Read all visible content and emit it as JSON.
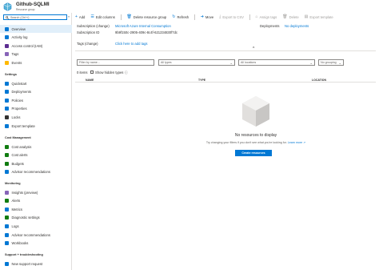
{
  "header": {
    "title": "Github-SQLMI",
    "subtitle": "Resource group"
  },
  "sidebar": {
    "search_placeholder": "Search (Ctrl+/)",
    "collapse_glyph": "«",
    "items_top": [
      {
        "label": "Overview",
        "color": "#0078d4"
      },
      {
        "label": "Activity log",
        "color": "#0078d4"
      },
      {
        "label": "Access control (IAM)",
        "color": "#5c2d91"
      },
      {
        "label": "Tags",
        "color": "#8764b8"
      },
      {
        "label": "Events",
        "color": "#ffb900"
      }
    ],
    "settings_header": "Settings",
    "items_settings": [
      {
        "label": "Quickstart",
        "color": "#0078d4"
      },
      {
        "label": "Deployments",
        "color": "#0078d4"
      },
      {
        "label": "Policies",
        "color": "#0078d4"
      },
      {
        "label": "Properties",
        "color": "#0078d4"
      },
      {
        "label": "Locks",
        "color": "#323130"
      },
      {
        "label": "Export template",
        "color": "#0078d4"
      }
    ],
    "cost_header": "Cost Management",
    "items_cost": [
      {
        "label": "Cost analysis",
        "color": "#107c10"
      },
      {
        "label": "Cost alerts",
        "color": "#107c10"
      },
      {
        "label": "Budgets",
        "color": "#107c10"
      },
      {
        "label": "Advisor recommendations",
        "color": "#0078d4"
      }
    ],
    "monitoring_header": "Monitoring",
    "items_monitoring": [
      {
        "label": "Insights (preview)",
        "color": "#8764b8"
      },
      {
        "label": "Alerts",
        "color": "#107c10"
      },
      {
        "label": "Metrics",
        "color": "#0078d4"
      },
      {
        "label": "Diagnostic settings",
        "color": "#107c10"
      },
      {
        "label": "Logs",
        "color": "#0078d4"
      },
      {
        "label": "Advisor recommendations",
        "color": "#0078d4"
      },
      {
        "label": "Workbooks",
        "color": "#0078d4"
      }
    ],
    "support_header": "Support + troubleshooting",
    "items_support": [
      {
        "label": "New support request",
        "color": "#0078d4"
      }
    ]
  },
  "toolbar": {
    "add": "Add",
    "edit_columns": "Edit columns",
    "delete_group": "Delete resource group",
    "refresh": "Refresh",
    "move": "Move",
    "export_csv": "Export to CSV",
    "assign_tags": "Assign tags",
    "delete": "Delete",
    "export_template": "Export template"
  },
  "essentials": {
    "subscription_label": "Subscription (change)",
    "subscription_value": "Microsoft Azure Internal Consumption",
    "subscription_id_label": "Subscription ID",
    "subscription_id_value": "9b9f150c-2905-409c-8c4f-621234830f7dc",
    "tags_label": "Tags (change)",
    "tags_value": "Click here to add tags",
    "deployments_label": "Deployments",
    "deployments_value": "No deployments",
    "collapse_glyph": "^"
  },
  "filters": {
    "name_placeholder": "Filter by name...",
    "type_value": "All types",
    "location_value": "All locations",
    "grouping_value": "No grouping"
  },
  "list": {
    "count": "0 items",
    "show_hidden": "Show hidden types",
    "info_glyph": "ⓘ",
    "columns": {
      "name": "NAME",
      "type": "TYPE",
      "location": "LOCATION"
    }
  },
  "empty_state": {
    "title": "No resources to display",
    "description": "Try changing your filters if you don't see what you're looking for.",
    "learn_more": "Learn more",
    "create_button": "Create resources"
  }
}
